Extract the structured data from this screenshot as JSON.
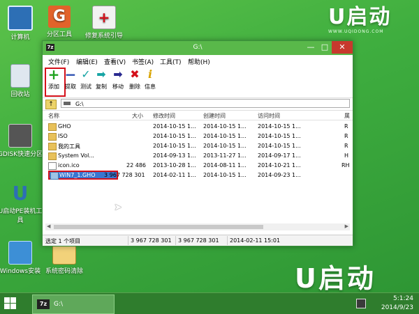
{
  "desktop": {
    "icons": [
      {
        "label": "计算机"
      },
      {
        "label": "分区工具"
      },
      {
        "label": "修复系统引导"
      },
      {
        "label": "回收站"
      },
      {
        "label": "GDISK快速分区"
      },
      {
        "label": "U启动PE装机工具"
      },
      {
        "label": "Windows安装"
      },
      {
        "label": "系统密码清除"
      }
    ],
    "brand_top": {
      "logo": "U启动",
      "url": "WWW.UQIDONG.COM"
    },
    "brand_bottom": {
      "logo": "U启动"
    }
  },
  "window": {
    "title": "G:\\",
    "app_icon": "7z",
    "controls": {
      "minimize": "—",
      "maximize": "□",
      "close": "✕"
    },
    "menu": [
      "文件(F)",
      "编辑(E)",
      "查看(V)",
      "书签(A)",
      "工具(T)",
      "帮助(H)"
    ],
    "toolbar": [
      {
        "label": "添加",
        "icon": "plus-icon",
        "color": "#1ea21e"
      },
      {
        "label": "提取",
        "icon": "minus-icon",
        "color": "#2a4fb0"
      },
      {
        "label": "测试",
        "icon": "check-icon",
        "color": "#18a5a5"
      },
      {
        "label": "复制",
        "icon": "copy-arrow-icon",
        "color": "#18a5a5"
      },
      {
        "label": "移动",
        "icon": "move-arrow-icon",
        "color": "#2a2a90"
      },
      {
        "label": "删除",
        "icon": "delete-x-icon",
        "color": "#d4101a"
      },
      {
        "label": "信息",
        "icon": "info-icon",
        "color": "#d9a400"
      }
    ],
    "address": "G:\\",
    "columns": [
      "名称",
      "大小",
      "修改时间",
      "创建时间",
      "访问时间",
      "属"
    ],
    "files": [
      {
        "name": "GHO",
        "size": "",
        "modified": "2014-10-15 1...",
        "created": "2014-10-15 1...",
        "accessed": "2014-10-15 1...",
        "attr": "R",
        "type": "folder"
      },
      {
        "name": "ISO",
        "size": "",
        "modified": "2014-10-15 1...",
        "created": "2014-10-15 1...",
        "accessed": "2014-10-15 1...",
        "attr": "R",
        "type": "folder"
      },
      {
        "name": "我的工具",
        "size": "",
        "modified": "2014-10-15 1...",
        "created": "2014-10-15 1...",
        "accessed": "2014-10-15 1...",
        "attr": "R",
        "type": "folder"
      },
      {
        "name": "System Vol...",
        "size": "",
        "modified": "2014-09-13 1...",
        "created": "2013-11-27 1...",
        "accessed": "2014-09-17 1...",
        "attr": "H",
        "type": "folder"
      },
      {
        "name": "icon.ico",
        "size": "22 486",
        "modified": "2013-10-28 1...",
        "created": "2014-08-11 1...",
        "accessed": "2014-10-21 1...",
        "attr": "RH",
        "type": "file"
      },
      {
        "name": "WIN7_1.GHO",
        "size": "3 967 728 301",
        "modified": "2014-02-11 1...",
        "created": "2014-10-15 1...",
        "accessed": "2014-09-23 1...",
        "attr": "",
        "type": "gho",
        "selected": true
      }
    ],
    "status": {
      "selection": "选定 1 个项目",
      "size1": "3 967 728 301",
      "size2": "3 967 728 301",
      "date": "2014-02-11 15:01"
    }
  },
  "taskbar": {
    "task_label": "G:\\",
    "task_icon": "7z",
    "time": "5:1:24",
    "date": "2014/9/23"
  }
}
